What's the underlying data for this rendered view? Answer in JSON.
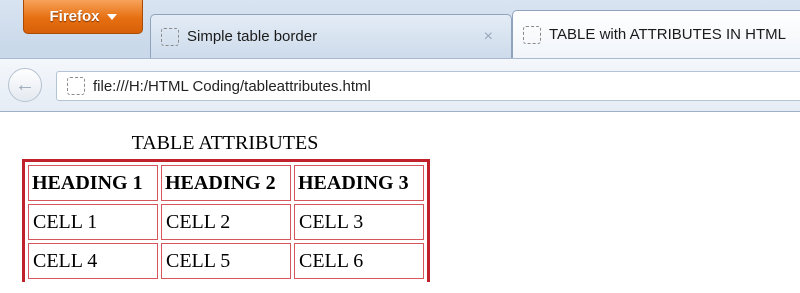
{
  "browser": {
    "menu_button_label": "Firefox",
    "tabs": [
      {
        "title": "Simple table border",
        "close_glyph": "×"
      },
      {
        "title": "TABLE with ATTRIBUTES IN HTML"
      }
    ],
    "url": "file:///H:/HTML Coding/tableattributes.html",
    "icons": {
      "back": "back-arrow-icon",
      "favicon": "blank-page-icon",
      "menu_caret": "caret-down-icon"
    }
  },
  "page": {
    "caption": "TABLE ATTRIBUTES",
    "table": {
      "headers": [
        "HEADING 1",
        "HEADING 2",
        "HEADING 3"
      ],
      "rows": [
        [
          "CELL 1",
          "CELL 2",
          "CELL 3"
        ],
        [
          "CELL 4",
          "CELL 5",
          "CELL 6"
        ]
      ],
      "border_color": "#c0222b"
    }
  },
  "colors": {
    "firefox_button": "#e66f12",
    "chrome_background": "#d9e4f1"
  }
}
